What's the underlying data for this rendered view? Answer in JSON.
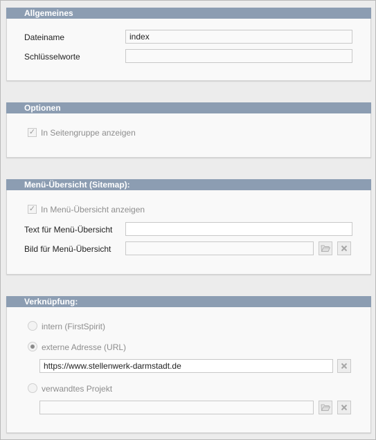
{
  "allgemeines": {
    "title": "Allgemeines",
    "dateiname_label": "Dateiname",
    "dateiname_value": "index",
    "schluesselworte_label": "Schlüsselworte",
    "schluesselworte_value": ""
  },
  "optionen": {
    "title": "Optionen",
    "seitengruppe_label": "In Seitengruppe anzeigen",
    "seitengruppe_checked": true
  },
  "menue": {
    "title": "Menü-Übersicht (Sitemap):",
    "anzeigen_label": "In Menü-Übersicht anzeigen",
    "anzeigen_checked": true,
    "text_label": "Text für Menü-Übersicht",
    "text_value": "",
    "bild_label": "Bild für Menü-Übersicht",
    "bild_value": ""
  },
  "verknuepfung": {
    "title": "Verknüpfung:",
    "intern_label": "intern (FirstSpirit)",
    "extern_label": "externe Adresse (URL)",
    "extern_url": "https://www.stellenwerk-darmstadt.de",
    "verwandt_label": "verwandtes Projekt",
    "verwandt_value": "",
    "selected": "extern"
  },
  "icons": {
    "folder": "folder-open-icon",
    "clear": "clear-x-icon",
    "check": "checkmark-icon"
  }
}
